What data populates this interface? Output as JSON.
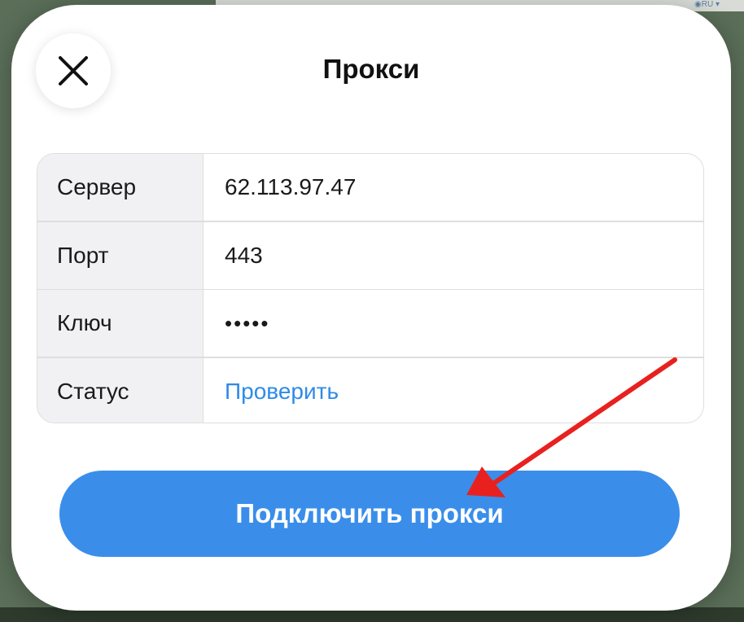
{
  "background": {
    "lang_label": "◉RU ▾"
  },
  "dialog": {
    "title": "Прокси",
    "close_icon": "close-icon"
  },
  "proxy_fields": [
    {
      "label": "Сервер",
      "value": "62.113.97.47"
    },
    {
      "label": "Порт",
      "value": "443"
    },
    {
      "label": "Ключ",
      "value": "•••••"
    },
    {
      "label": "Статус",
      "value": "Проверить"
    }
  ],
  "connect_button": {
    "label": "Подключить прокси"
  },
  "colors": {
    "accent": "#3a8eea",
    "link": "#2e8be8",
    "annotation_arrow": "#e8211f"
  }
}
